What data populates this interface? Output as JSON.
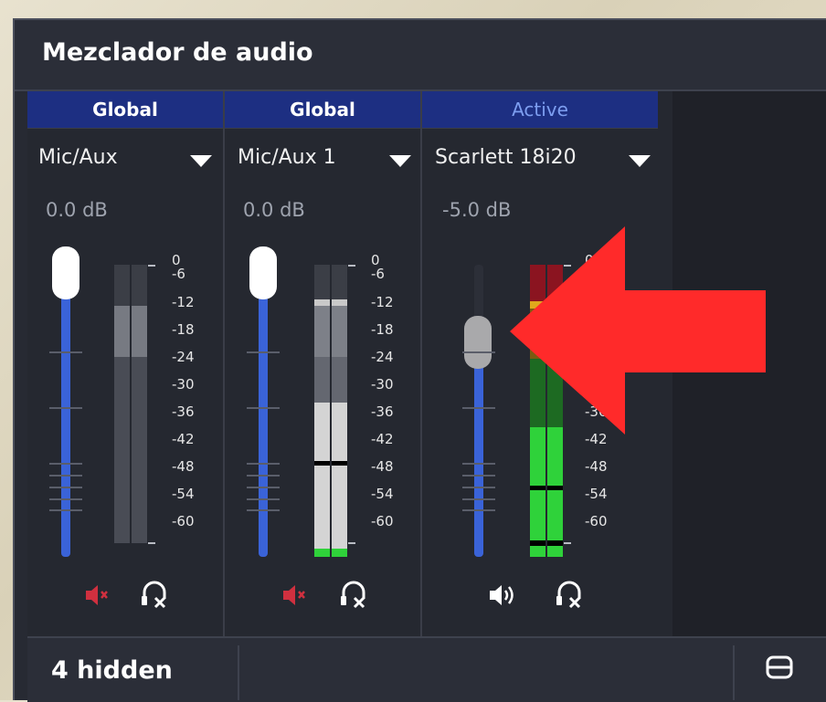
{
  "dock": {
    "title": "Mezclador de audio"
  },
  "channels": [
    {
      "header": "Global",
      "device": "Mic/Aux",
      "volume": "0.0 dB",
      "volume_level": 1.0
    },
    {
      "header": "Global",
      "device": "Mic/Aux 1",
      "volume": "0.0 dB",
      "volume_level": 1.0
    },
    {
      "header": "Active",
      "device": "Scarlett 18i20",
      "volume": "-5.0 dB",
      "volume_level": 0.77
    }
  ],
  "meter_scale": [
    "0",
    "-6",
    "-12",
    "-18",
    "-24",
    "-30",
    "-36",
    "-42",
    "-48",
    "-54",
    "-60"
  ],
  "footer": {
    "hidden_label": "4 hidden"
  },
  "icons": {
    "muted": "muted-speaker-icon",
    "speaker": "speaker-icon",
    "monitor_off": "headphones-off-icon",
    "layout": "layout-icon",
    "annotation": "red-arrow"
  },
  "colors": {
    "header_bg": "#1d2f82",
    "active_header_text": "#7d9ef0",
    "fader_fill": "#3a63d8",
    "muted_icon": "#d0303f",
    "meter_green": "#2fd23a",
    "meter_yellow": "#e0a81c",
    "meter_red": "#8b1420",
    "annotation_arrow": "#ff2a2a"
  }
}
